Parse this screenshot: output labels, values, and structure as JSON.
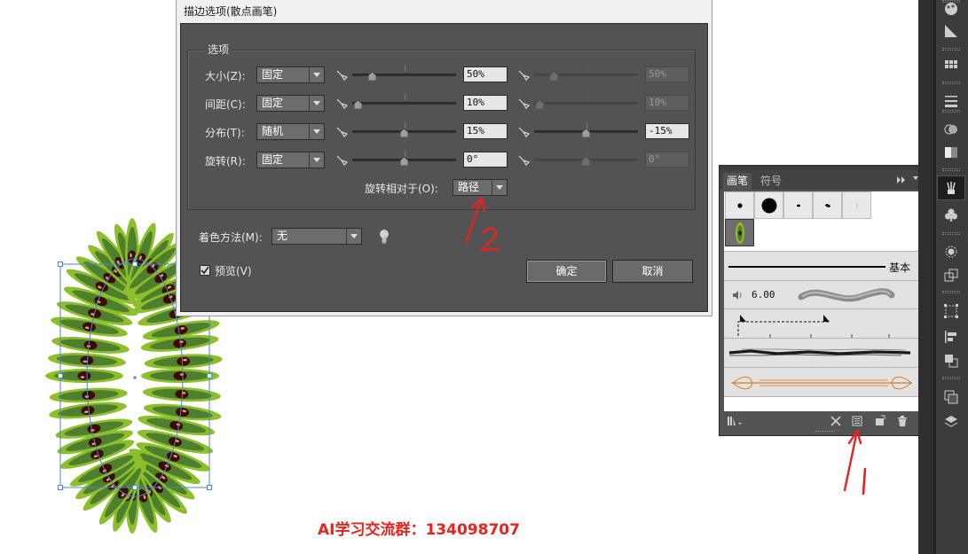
{
  "dialog": {
    "title": "描边选项(散点画笔)",
    "group_label": "选项",
    "rows": [
      {
        "label": "大小(Z):",
        "method": "固定",
        "value1": "50%",
        "value2": "50%",
        "value2_enabled": false,
        "thumb1": 0.17,
        "thumb2": 0.17
      },
      {
        "label": "间距(C):",
        "method": "固定",
        "value1": "10%",
        "value2": "10%",
        "value2_enabled": false,
        "thumb1": 0.02,
        "thumb2": 0.02
      },
      {
        "label": "分布(T):",
        "method": "随机",
        "value1": "15%",
        "value2": "-15%",
        "value2_enabled": true,
        "thumb1": 0.5,
        "thumb2": 0.5
      },
      {
        "label": "旋转(R):",
        "method": "固定",
        "value1": "0°",
        "value2": "0°",
        "value2_enabled": false,
        "thumb1": 0.5,
        "thumb2": 0.5
      }
    ],
    "rotation_relative_label": "旋转相对于(O):",
    "rotation_relative_value": "路径",
    "colorization_label": "着色方法(M):",
    "colorization_value": "无",
    "preview_label": "预览(V)",
    "preview_checked": true,
    "ok_label": "确定",
    "cancel_label": "取消"
  },
  "brush_panel": {
    "tabs": [
      "画笔",
      "符号"
    ],
    "active_tab": "画笔",
    "basic_label": "基本",
    "calligraphic_size": "6.00"
  },
  "annotations": {
    "group_text": "AI学习交流群：134098707",
    "marker_1": "1",
    "marker_2": "2",
    "marker_color": "#e8231d"
  },
  "colors": {
    "dark_green": "#4e7f2e",
    "light_green": "#8cbf2a",
    "seed": "#3d0a05",
    "selection": "#4a86d8"
  }
}
